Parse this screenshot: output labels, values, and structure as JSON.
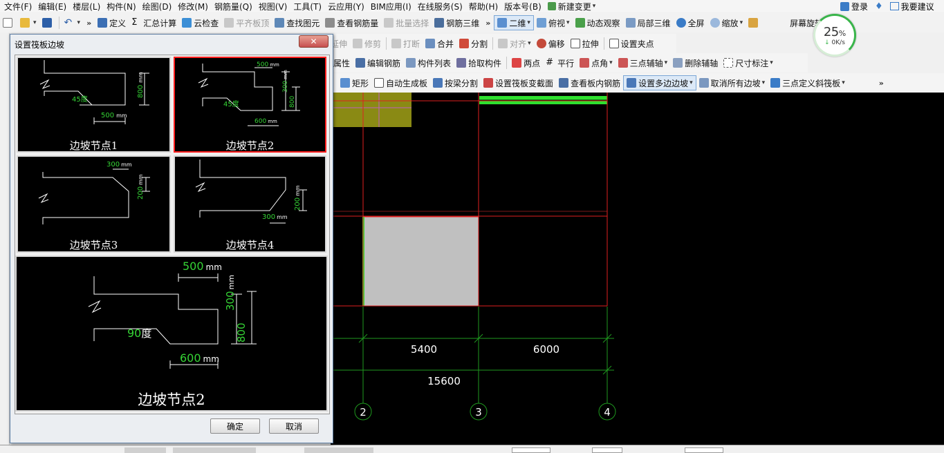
{
  "menu": [
    "文件(F)",
    "编辑(E)",
    "楼层(L)",
    "构件(N)",
    "绘图(D)",
    "修改(M)",
    "钢筋量(Q)",
    "视图(V)",
    "工具(T)",
    "云应用(Y)",
    "BIM应用(I)",
    "在线服务(S)",
    "帮助(H)",
    "版本号(B)",
    "新建变更"
  ],
  "account": {
    "login": "登录",
    "suggest": "我要建议"
  },
  "speed": {
    "percent": "25",
    "pct_sign": "%",
    "rate": "0K/s"
  },
  "toolbar1": {
    "define": "定义",
    "summary": "汇总计算",
    "cloud_check": "云检查",
    "flat_top": "平齐板顶",
    "find_elem": "查找图元",
    "view_rebar": "查看钢筋量",
    "batch_select": "批量选择",
    "rebar_3d": "钢筋三维",
    "view_2d": "二维",
    "top_view": "俯视",
    "dyn_observe": "动态观察",
    "local_3d": "局部三维",
    "full_screen": "全屏",
    "zoom": "缩放",
    "rotate": "屏幕旋转"
  },
  "toolbar2": {
    "extend": "延伸",
    "trim": "修剪",
    "break": "打断",
    "merge": "合并",
    "split": "分割",
    "align": "对齐",
    "offset": "偏移",
    "stretch": "拉伸",
    "grip": "设置夹点"
  },
  "toolbar3": {
    "prop": "属性",
    "edit_rebar": "编辑钢筋",
    "elem_list": "构件列表",
    "pick_elem": "拾取构件",
    "two_points": "两点",
    "parallel": "平行",
    "point_angle": "点角",
    "three_point_axis": "三点辅轴",
    "delete_axis": "删除辅轴",
    "dim": "尺寸标注"
  },
  "toolbar4": {
    "rect": "矩形",
    "auto_gen": "自动生成板",
    "split_by_beam": "按梁分割",
    "set_section": "设置筏板变截面",
    "view_inner_rebar": "查看板内钢筋",
    "set_multi_edge": "设置多边边坡",
    "cancel_all_edges": "取消所有边坡",
    "three_point_slope": "三点定义斜筏板"
  },
  "canvas": {
    "dims": {
      "span_23": "5400",
      "span_34": "6000",
      "total": "15600"
    },
    "axes": [
      "2",
      "3",
      "4"
    ]
  },
  "dialog": {
    "title": "设置筏板边坡",
    "close_label": "✕",
    "nodes": [
      {
        "caption": "边坡节点1",
        "angle": "45度",
        "h": "800",
        "w": "500",
        "unit": "mm"
      },
      {
        "caption": "边坡节点2",
        "angle": "45度",
        "h1": "300",
        "h2": "800",
        "w1": "500",
        "w2": "600",
        "unit": "mm"
      },
      {
        "caption": "边坡节点3",
        "w": "300",
        "h": "200",
        "unit": "mm"
      },
      {
        "caption": "边坡节点4",
        "w": "300",
        "h": "200",
        "unit": "mm"
      }
    ],
    "preview": {
      "caption": "边坡节点2",
      "angle_value": "90",
      "angle_unit": "度",
      "w1": "500",
      "w2": "600",
      "h1": "300",
      "h2": "800",
      "unit": "mm"
    },
    "ok": "确定",
    "cancel": "取消"
  },
  "colors": {
    "accent_selected": "#ff2020",
    "dim_green": "#35d435",
    "grid_red": "#e02020",
    "slab_gray": "#c0c0c0"
  }
}
